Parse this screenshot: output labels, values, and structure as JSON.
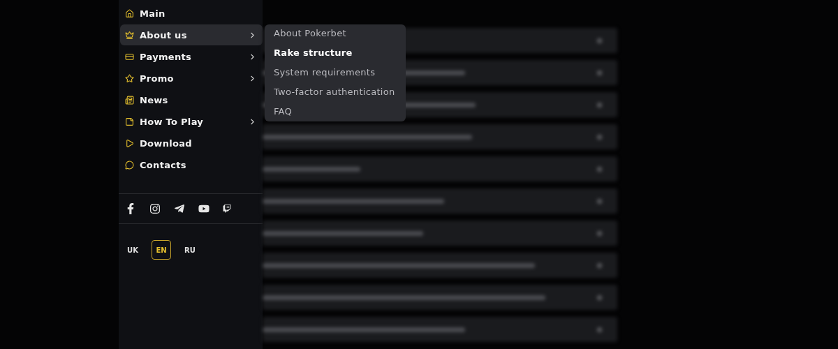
{
  "sidebar": {
    "items": [
      {
        "label": "Main",
        "selected": false,
        "has_submenu": false
      },
      {
        "label": "About us",
        "selected": true,
        "has_submenu": true
      },
      {
        "label": "Payments",
        "selected": false,
        "has_submenu": true
      },
      {
        "label": "Promo",
        "selected": false,
        "has_submenu": true
      },
      {
        "label": "News",
        "selected": false,
        "has_submenu": false
      },
      {
        "label": "How To Play",
        "selected": false,
        "has_submenu": true
      },
      {
        "label": "Download",
        "selected": false,
        "has_submenu": false
      },
      {
        "label": "Contacts",
        "selected": false,
        "has_submenu": false
      }
    ],
    "languages": [
      {
        "label": "UK",
        "selected": false
      },
      {
        "label": "EN",
        "selected": true
      },
      {
        "label": "RU",
        "selected": false
      }
    ]
  },
  "submenu": {
    "items": [
      {
        "label": "About Pokerbet",
        "selected": false
      },
      {
        "label": "Rake structure",
        "selected": true
      },
      {
        "label": "System requirements",
        "selected": false
      },
      {
        "label": "Two-factor authentication",
        "selected": false
      },
      {
        "label": "FAQ",
        "selected": false
      }
    ]
  },
  "background": {
    "kind": "blurred-faq"
  }
}
